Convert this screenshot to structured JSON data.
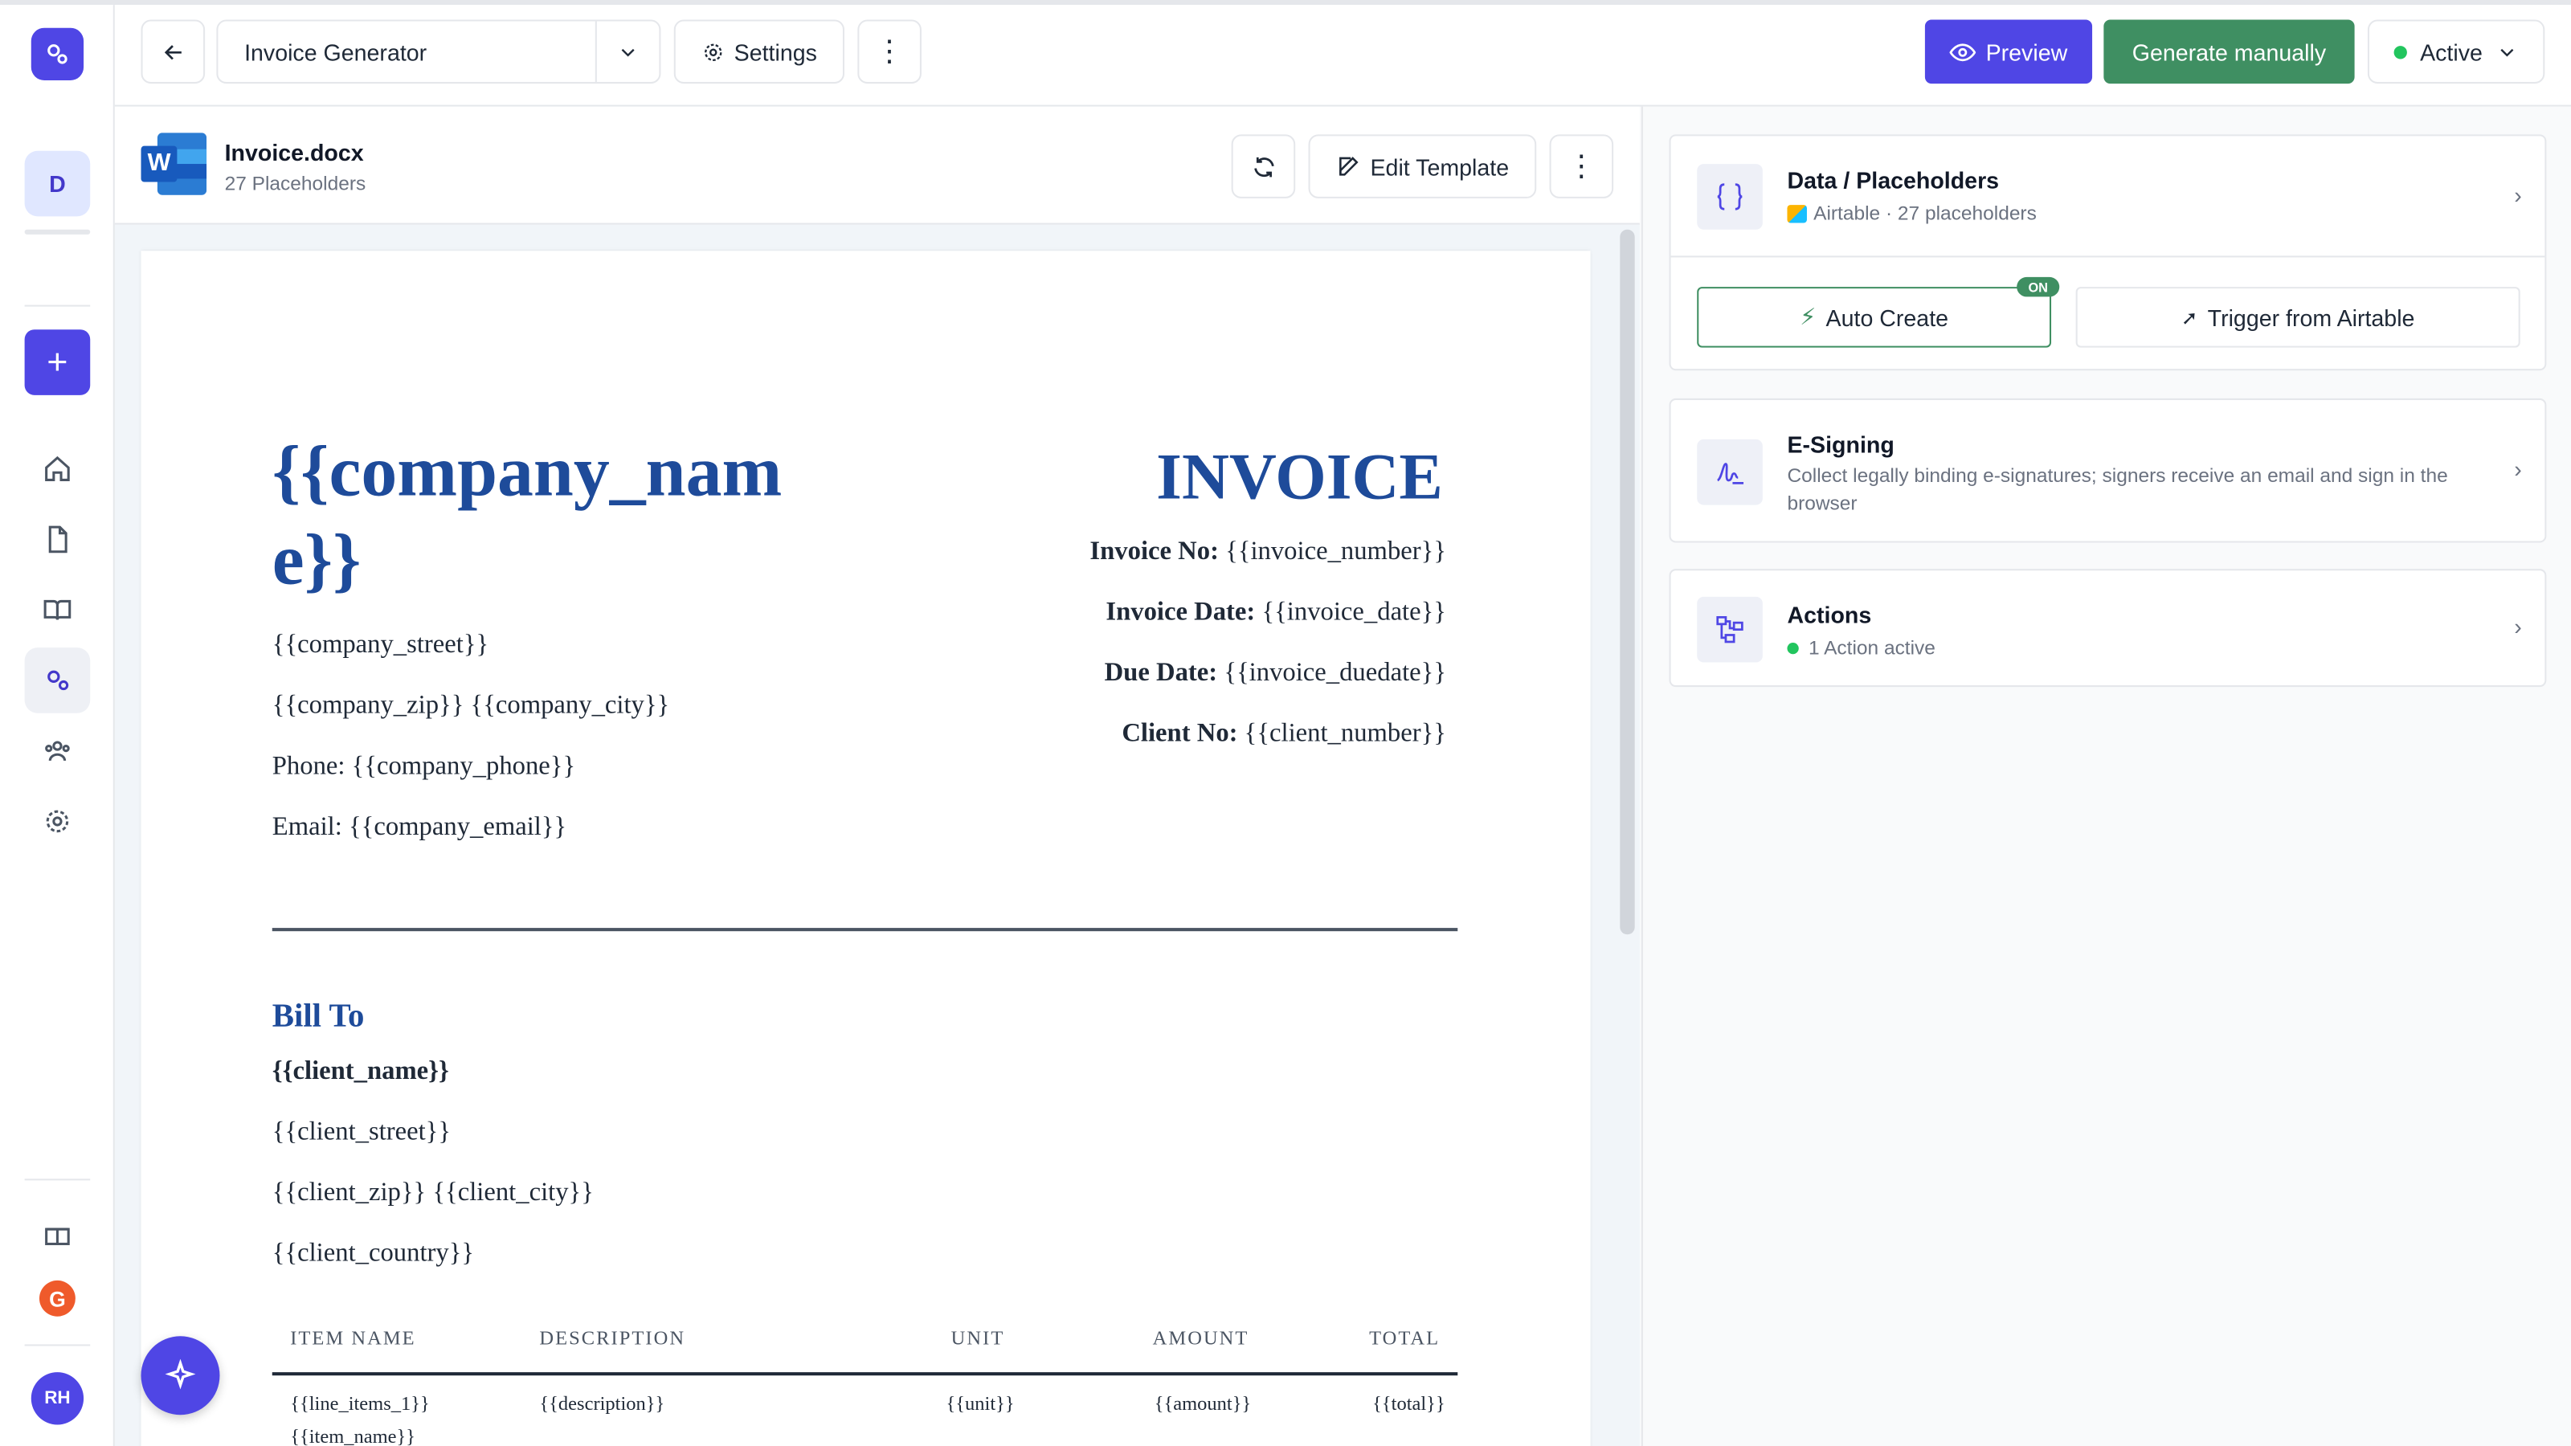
{
  "topbar": {
    "template_name": "Invoice Generator",
    "settings_label": "Settings",
    "preview_label": "Preview",
    "generate_label": "Generate manually",
    "status_label": "Active",
    "status_color": "#22c55e"
  },
  "sidebar": {
    "workspace_initial": "D",
    "user_initials": "RH",
    "g2_label": "G",
    "items": [
      {
        "name": "home-icon"
      },
      {
        "name": "document-icon"
      },
      {
        "name": "book-icon"
      },
      {
        "name": "gears-icon",
        "active": true
      },
      {
        "name": "users-icon"
      },
      {
        "name": "settings-icon"
      }
    ]
  },
  "file": {
    "name": "Invoice.docx",
    "subtitle": "27 Placeholders",
    "word_letter": "W",
    "edit_label": "Edit Template"
  },
  "document": {
    "company_name": "{{company_name}}",
    "company_lines": [
      "{{company_street}}",
      "{{company_zip}} {{company_city}}",
      "Phone: {{company_phone}}",
      "Email: {{company_email}}"
    ],
    "invoice_title": "INVOICE",
    "meta": [
      {
        "label": "Invoice No:",
        "value": " {{invoice_number}}"
      },
      {
        "label": "Invoice Date:",
        "value": " {{invoice_date}}"
      },
      {
        "label": "Due Date:",
        "value": " {{invoice_duedate}}"
      },
      {
        "label": "Client No:",
        "value": " {{client_number}}"
      }
    ],
    "bill_to_title": "Bill To",
    "client_name": "{{client_name}}",
    "client_lines": [
      "{{client_street}}",
      "{{client_zip}} {{client_city}}",
      "{{client_country}}"
    ],
    "table_headers": [
      "ITEM NAME",
      "DESCRIPTION",
      "UNIT",
      "AMOUNT",
      "TOTAL"
    ],
    "table_row": [
      "{{line_items_1}}",
      "{{item_name}}",
      "{{description}}",
      "{{unit}}",
      "{{amount}}",
      "{{total}}"
    ]
  },
  "panel": {
    "data_title": "Data / Placeholders",
    "data_sub": "Airtable · 27 placeholders",
    "auto_create_label": "Auto Create",
    "on_badge": "ON",
    "trigger_label": "Trigger from Airtable",
    "esign_title": "E-Signing",
    "esign_sub": "Collect legally binding e-signatures; signers receive an email and sign in the browser",
    "actions_title": "Actions",
    "actions_sub": "1 Action active"
  },
  "colors": {
    "accent": "#4f46e5",
    "green": "#3f8f62",
    "doc_blue": "#1e4b9a"
  }
}
